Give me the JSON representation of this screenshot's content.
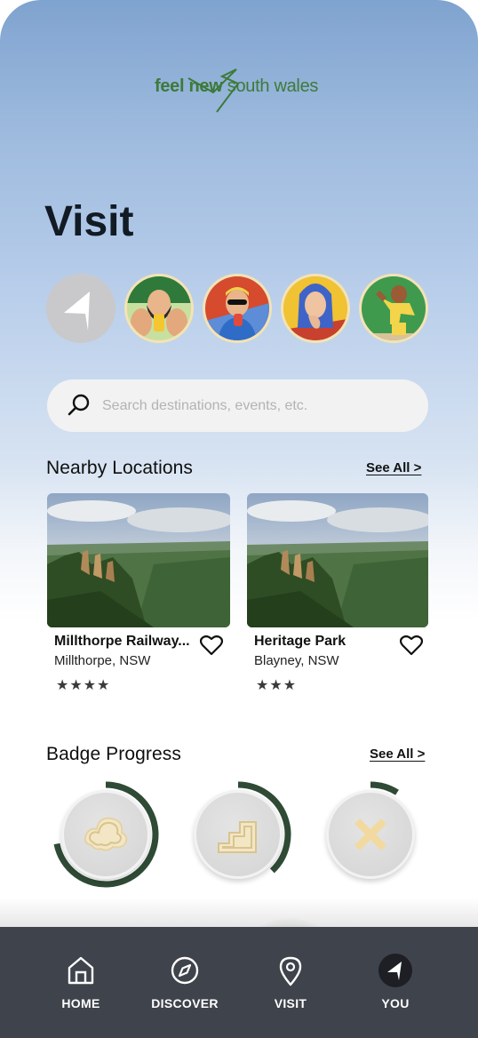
{
  "logo": {
    "text_bold": "feel new",
    "text_regular": " south wales"
  },
  "page": {
    "title": "Visit"
  },
  "stories": [
    {
      "icon": "location-arrow-icon"
    },
    {
      "icon": "avatar-bearded-man"
    },
    {
      "icon": "avatar-sunglasses-man"
    },
    {
      "icon": "avatar-blue-hair-woman"
    },
    {
      "icon": "avatar-teacher"
    }
  ],
  "search": {
    "placeholder": "Search destinations, events, etc.",
    "value": ""
  },
  "nearby": {
    "title": "Nearby Locations",
    "see_all": "See All >",
    "cards": [
      {
        "name": "Millthorpe Railway...",
        "location": "Millthorpe, NSW",
        "stars": "★★★★",
        "rating": 4
      },
      {
        "name": "Heritage Park",
        "location": "Blayney, NSW",
        "stars": "★★★",
        "rating": 3
      }
    ]
  },
  "badges": {
    "title": "Badge Progress",
    "see_all": "See All >",
    "items": [
      {
        "icon": "cloud-icon",
        "progress": 0.72
      },
      {
        "icon": "stairs-icon",
        "progress": 0.38
      },
      {
        "icon": "close-x-icon",
        "progress": 0.09
      }
    ]
  },
  "nav": {
    "items": [
      {
        "label": "HOME",
        "icon": "home-icon"
      },
      {
        "label": "DISCOVER",
        "icon": "compass-icon"
      },
      {
        "label": "VISIT",
        "icon": "location-pin-icon",
        "active": true
      },
      {
        "label": "YOU",
        "icon": "profile-arrow-icon"
      }
    ]
  },
  "colors": {
    "brand_green": "#3d7a3a",
    "ring_green": "#2f4a35",
    "nav_bg": "#3f434b",
    "badge_icon": "#f2e6c4"
  }
}
